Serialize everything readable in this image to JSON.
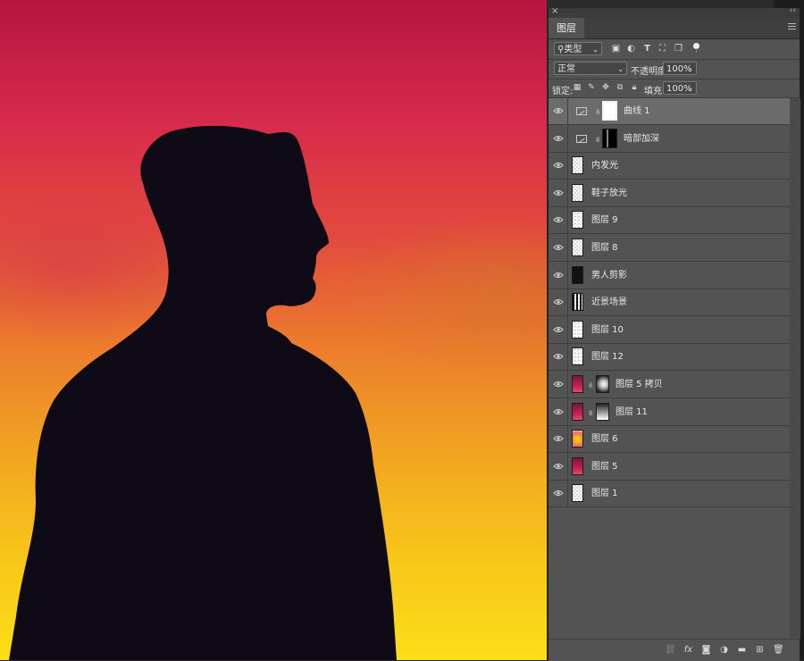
{
  "panel": {
    "close_glyph": "×",
    "collapse_glyph": "‹‹",
    "tab_label": "图层"
  },
  "filter": {
    "kind_label": "类型",
    "icons": [
      "image-filter-icon",
      "adjustment-filter-icon",
      "type-filter-icon",
      "shape-filter-icon",
      "smart-object-filter-icon"
    ]
  },
  "blend": {
    "mode": "正常",
    "opacity_label": "不透明度:",
    "opacity_value": "100%"
  },
  "lock": {
    "label": "锁定:",
    "fill_label": "填充:",
    "fill_value": "100%"
  },
  "layers": [
    {
      "name": "曲线 1",
      "kind": "adjustment",
      "mask": "white",
      "selected": true
    },
    {
      "name": "暗部加深",
      "kind": "adjustment",
      "mask": "silhouette",
      "selected": false
    },
    {
      "name": "内发光",
      "kind": "pixel",
      "thumb": "transparent",
      "selected": false
    },
    {
      "name": "鞋子放光",
      "kind": "pixel",
      "thumb": "transparent",
      "selected": false
    },
    {
      "name": "图层 9",
      "kind": "pixel",
      "thumb": "sketch",
      "selected": false
    },
    {
      "name": "图层 8",
      "kind": "pixel",
      "thumb": "transparent",
      "selected": false
    },
    {
      "name": "男人剪影",
      "kind": "pixel",
      "thumb": "man",
      "selected": false
    },
    {
      "name": "近景场景",
      "kind": "pixel",
      "thumb": "scene",
      "selected": false
    },
    {
      "name": "图层 10",
      "kind": "pixel",
      "thumb": "sketch",
      "selected": false
    },
    {
      "name": "图层 12",
      "kind": "pixel",
      "thumb": "sketch",
      "selected": false
    },
    {
      "name": "图层 5 拷贝",
      "kind": "masked",
      "thumb": "gradient",
      "mask": "radial",
      "selected": false
    },
    {
      "name": "图层 11",
      "kind": "masked",
      "thumb": "gradient",
      "mask": "linear",
      "selected": false
    },
    {
      "name": "图层 6",
      "kind": "pixel",
      "thumb": "glow",
      "selected": false
    },
    {
      "name": "图层 5",
      "kind": "pixel",
      "thumb": "gradient",
      "selected": false
    },
    {
      "name": "图层 1",
      "kind": "pixel",
      "thumb": "transparent",
      "selected": false
    }
  ],
  "colors": {
    "panel_bg": "#535353",
    "selected_row": "#6b6b6b",
    "sky_top": "#b3163f",
    "sky_bottom": "#fadf16",
    "silhouette": "#0d0b16"
  }
}
